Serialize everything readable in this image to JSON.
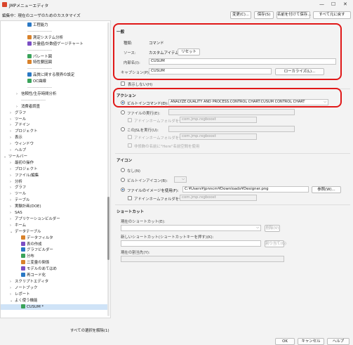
{
  "window": {
    "title": "JMPメニューエディタ"
  },
  "edit_target": "編集中：現在のユーザのためのカスタマイズ",
  "toolbar": {
    "change": "変更(C)...",
    "save": "保存(S)",
    "save_as": "名前を付けて保存...",
    "expand_all": "すべて元に戻す"
  },
  "tree": {
    "items": [
      {
        "label": "工程能力",
        "indent": 3,
        "icon": "chart-icon",
        "chev": ""
      },
      {
        "label": "------------------",
        "indent": 3,
        "icon": "",
        "chev": ""
      },
      {
        "label": "測定システム分析",
        "indent": 3,
        "icon": "chart-icon",
        "chev": ""
      },
      {
        "label": "計量値/計数値ゲージチャート",
        "indent": 3,
        "icon": "chart-icon",
        "chev": ""
      },
      {
        "label": "------------------",
        "indent": 3,
        "icon": "",
        "chev": ""
      },
      {
        "label": "パレート図",
        "indent": 3,
        "icon": "chart-icon",
        "chev": ""
      },
      {
        "label": "特性要因図",
        "indent": 3,
        "icon": "chart-icon",
        "chev": ""
      },
      {
        "label": "------------------",
        "indent": 3,
        "icon": "",
        "chev": ""
      },
      {
        "label": "品質に関する限界の設定",
        "indent": 3,
        "icon": "chart-icon",
        "chev": ""
      },
      {
        "label": "OC曲線",
        "indent": 3,
        "icon": "chart-icon",
        "chev": ""
      },
      {
        "label": "------------------",
        "indent": 3,
        "icon": "",
        "chev": ""
      },
      {
        "label": "信頼性/生存時間分析",
        "indent": 2,
        "icon": "",
        "chev": ">"
      },
      {
        "label": "------------------",
        "indent": 2,
        "icon": "",
        "chev": ""
      },
      {
        "label": "消費者調査",
        "indent": 2,
        "icon": "",
        "chev": ">"
      },
      {
        "label": "グラフ",
        "indent": 1,
        "icon": "",
        "chev": ">"
      },
      {
        "label": "ツール",
        "indent": 1,
        "icon": "",
        "chev": ">"
      },
      {
        "label": "アドイン",
        "indent": 1,
        "icon": "",
        "chev": ">"
      },
      {
        "label": "プロジェクト",
        "indent": 1,
        "icon": "",
        "chev": ">"
      },
      {
        "label": "表示",
        "indent": 1,
        "icon": "",
        "chev": ">"
      },
      {
        "label": "ウィンドウ",
        "indent": 1,
        "icon": "",
        "chev": ">"
      },
      {
        "label": "ヘルプ",
        "indent": 1,
        "icon": "",
        "chev": ">"
      },
      {
        "label": "ツールバー",
        "indent": 0,
        "icon": "",
        "chev": "v"
      },
      {
        "label": "最初の操作",
        "indent": 1,
        "icon": "",
        "chev": ">"
      },
      {
        "label": "プロジェクト",
        "indent": 1,
        "icon": "",
        "chev": ">"
      },
      {
        "label": "ファイル/編集",
        "indent": 1,
        "icon": "",
        "chev": ">"
      },
      {
        "label": "分析",
        "indent": 1,
        "icon": "",
        "chev": ">"
      },
      {
        "label": "グラフ",
        "indent": 1,
        "icon": "",
        "chev": ">"
      },
      {
        "label": "ツール",
        "indent": 1,
        "icon": "",
        "chev": ">"
      },
      {
        "label": "テーブル",
        "indent": 1,
        "icon": "",
        "chev": ">"
      },
      {
        "label": "実験計画(DOE)",
        "indent": 1,
        "icon": "",
        "chev": ">"
      },
      {
        "label": "SAS",
        "indent": 1,
        "icon": "",
        "chev": ">"
      },
      {
        "label": "アプリケーションビルダー",
        "indent": 1,
        "icon": "",
        "chev": ">"
      },
      {
        "label": "ホーム",
        "indent": 1,
        "icon": "",
        "chev": ">"
      },
      {
        "label": "データテーブル",
        "indent": 1,
        "icon": "",
        "chev": "v"
      },
      {
        "label": "データフィルタ",
        "indent": 2,
        "icon": "chart-icon",
        "chev": ""
      },
      {
        "label": "表の作成",
        "indent": 2,
        "icon": "chart-icon",
        "chev": ""
      },
      {
        "label": "グラフビルダー",
        "indent": 2,
        "icon": "chart-icon",
        "chev": ""
      },
      {
        "label": "分布",
        "indent": 2,
        "icon": "chart-icon",
        "chev": ""
      },
      {
        "label": "二変量の関係",
        "indent": 2,
        "icon": "chart-icon",
        "chev": ""
      },
      {
        "label": "モデルのあてはめ",
        "indent": 2,
        "icon": "chart-icon",
        "chev": ""
      },
      {
        "label": "再コード化",
        "indent": 2,
        "icon": "chart-icon",
        "chev": ""
      },
      {
        "label": "スクリプトエディタ",
        "indent": 1,
        "icon": "",
        "chev": ">"
      },
      {
        "label": "ノートブック",
        "indent": 1,
        "icon": "",
        "chev": ">"
      },
      {
        "label": "レポート",
        "indent": 1,
        "icon": "",
        "chev": ">"
      },
      {
        "label": "よく使う機能",
        "indent": 1,
        "icon": "",
        "chev": "v"
      },
      {
        "label": "CUSUM *",
        "indent": 2,
        "icon": "chart-icon",
        "chev": "",
        "selected": true
      }
    ],
    "deselect_all": "すべての選択を解除(1)"
  },
  "general": {
    "heading": "一般",
    "type_label": "種類:",
    "type_value": "コマンド",
    "source_label": "ソース:",
    "source_value": "カスタムアイテム",
    "reset_button": "リセット",
    "internal_name_label": "内部名(I):",
    "internal_name_value": "CUSUM",
    "caption_label": "キャプション(P):",
    "caption_value": "CUSUM",
    "localize_button": "ローカライズ(L)...",
    "hide_label": "表示しない(H)"
  },
  "action": {
    "heading": "アクション",
    "builtin_label": "ビルトインコマンド(D):",
    "builtin_value": "ANALYZE:QUALITY AND PROCESS:CONTROL CHART:CUSUM CONTROL CHART",
    "run_file_label": "ファイルの実行(E):",
    "home_folder_label": "アドインホームフォルダを使用(U):",
    "home_folder_placeholder": "com.jmp.rxgboost",
    "run_jsl_label": "このJSLを実行(U):",
    "home_folder2_label": "アドインホームフォルダを使用:",
    "home_folder2_placeholder": "com.jmp.rxgboost",
    "here_label": "非修飾の名前に\"Here\"名前空間を使用"
  },
  "icon": {
    "heading": "アイコン",
    "none_label": "なし(N)",
    "builtin_icon_label": "ビルトインアイコン(B):",
    "file_image_label": "ファイルのイメージを使用(F):",
    "file_image_value": "C:¥Users¥jpnncm¥Downloads¥Designer.png",
    "browse_button": "参照(W)...",
    "home_folder_label": "アドインホームフォルダを使用(U):",
    "home_folder_placeholder": "com.jmp.rxgboost"
  },
  "shortcut": {
    "heading": "ショートカット",
    "current_label": "現在のショートカット(E):",
    "delete_button": "削除(V)",
    "new_label": "新しいショートカット(ショートカットキーを押す)(K):",
    "assign_button": "割り当て(G)",
    "current_assign_label": "現在の割当先(Y):"
  },
  "footer": {
    "ok": "OK",
    "cancel": "キャンセル",
    "help": "ヘルプ"
  },
  "colors": {
    "highlight_red": "#e01818",
    "selected_row": "#cfe3f7"
  }
}
